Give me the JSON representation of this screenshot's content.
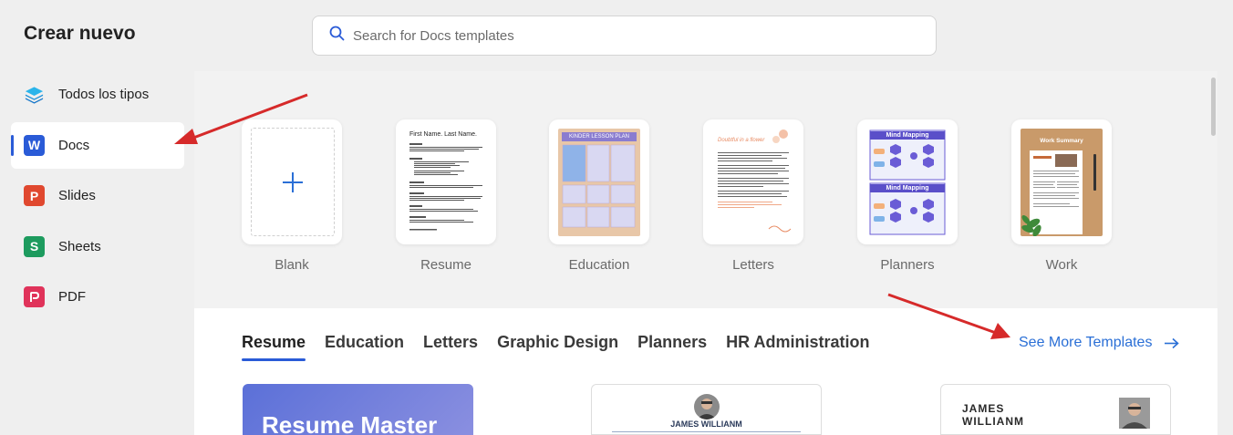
{
  "header": {
    "title": "Crear nuevo"
  },
  "search": {
    "placeholder": "Search for Docs templates"
  },
  "sidebar": {
    "items": [
      {
        "label": "Todos los tipos",
        "icon": "layers-icon",
        "color": "#1aa3e6"
      },
      {
        "label": "Docs",
        "icon": "docs-icon",
        "letter": "W",
        "color": "#2a5bd7",
        "active": true
      },
      {
        "label": "Slides",
        "icon": "slides-icon",
        "letter": "P",
        "color": "#e0482f"
      },
      {
        "label": "Sheets",
        "icon": "sheets-icon",
        "letter": "S",
        "color": "#1d9b5e"
      },
      {
        "label": "PDF",
        "icon": "pdf-icon",
        "color": "#e0335a"
      }
    ]
  },
  "featured": {
    "cards": [
      {
        "label": "Blank"
      },
      {
        "label": "Resume",
        "thumb_title": "First Name. Last Name."
      },
      {
        "label": "Education",
        "thumb_title": "KINDER LESSON PLAN"
      },
      {
        "label": "Letters",
        "thumb_title": "Doubtful in a flower"
      },
      {
        "label": "Planners",
        "thumb_title": "Mind Mapping"
      },
      {
        "label": "Work",
        "thumb_title": "Work Summary"
      }
    ]
  },
  "tabs": [
    {
      "label": "Resume",
      "active": true
    },
    {
      "label": "Education"
    },
    {
      "label": "Letters"
    },
    {
      "label": "Graphic Design"
    },
    {
      "label": "Planners"
    },
    {
      "label": "HR Administration"
    }
  ],
  "see_more": {
    "label": "See More Templates"
  },
  "templates": [
    {
      "title": "Resume Master"
    },
    {
      "name": "JAMES WILLIANM"
    },
    {
      "name_line1": "JAMES",
      "name_line2": "WILLIANM"
    }
  ],
  "colors": {
    "accent": "#2a5bd7",
    "link": "#2a6fd6",
    "arrow": "#d62a2a"
  }
}
